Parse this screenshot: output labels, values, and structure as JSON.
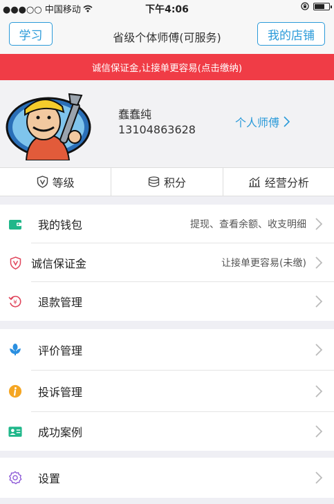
{
  "status_bar": {
    "carrier": "●●●○○ 中国移动",
    "time": "下午4:06"
  },
  "nav": {
    "left_button": "学习",
    "title": "省级个体师傅(可服务)",
    "right_button": "我的店铺"
  },
  "banner": {
    "text": "诚信保证金,让接单更容易(点击缴纳)"
  },
  "profile": {
    "name": "蠢蠢纯",
    "phone": "13104863628",
    "type": "个人师傅"
  },
  "stats": [
    {
      "label": "等级",
      "icon": "shield-v-icon"
    },
    {
      "label": "积分",
      "icon": "coins-icon"
    },
    {
      "label": "经营分析",
      "icon": "analytics-chart-icon"
    }
  ],
  "groups": [
    [
      {
        "label": "我的钱包",
        "detail": "提现、查看余额、收支明细",
        "icon": "wallet-icon",
        "color": "#1fb78a"
      },
      {
        "label": "诚信保证金",
        "detail": "让接单更容易(未缴)",
        "icon": "shield-v-icon",
        "color": "#e0455b"
      },
      {
        "label": "退款管理",
        "detail": "",
        "icon": "refund-icon",
        "color": "#e0455b"
      }
    ],
    [
      {
        "label": "评价管理",
        "detail": "",
        "icon": "flower-icon",
        "color": "#2a8fe0"
      },
      {
        "label": "投诉管理",
        "detail": "",
        "icon": "info-icon",
        "color": "#f5a623"
      },
      {
        "label": "成功案例",
        "detail": "",
        "icon": "id-card-icon",
        "color": "#1fb78a"
      }
    ],
    [
      {
        "label": "设置",
        "detail": "",
        "icon": "gear-icon",
        "color": "#8a55d6"
      }
    ]
  ]
}
